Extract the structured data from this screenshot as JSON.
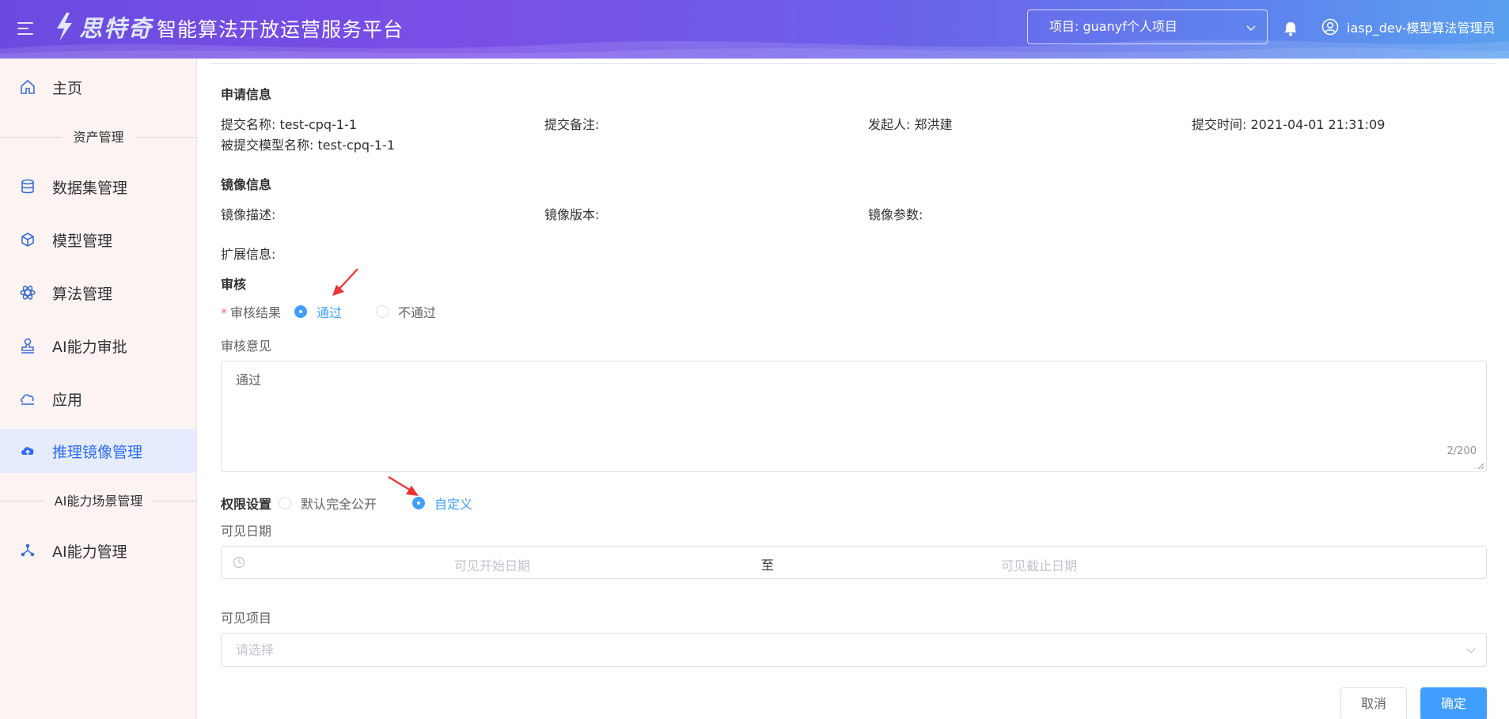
{
  "header": {
    "logo_text": "思特奇",
    "title": "智能算法开放运营服务平台",
    "project_select": "项目: guanyf个人项目",
    "user": "iasp_dev-模型算法管理员"
  },
  "sidebar": {
    "items": [
      {
        "label": "主页",
        "icon": "home-icon"
      },
      {
        "label": "数据集管理",
        "icon": "database-icon"
      },
      {
        "label": "模型管理",
        "icon": "cube-icon"
      },
      {
        "label": "算法管理",
        "icon": "atom-icon"
      },
      {
        "label": "AI能力审批",
        "icon": "stamp-icon"
      },
      {
        "label": "应用",
        "icon": "cloud-icon"
      },
      {
        "label": "推理镜像管理",
        "icon": "cloud-upload-icon",
        "active": true
      },
      {
        "label": "AI能力管理",
        "icon": "network-icon"
      }
    ],
    "groups": [
      "资产管理",
      "AI能力场景管理"
    ]
  },
  "application_info": {
    "title": "申请信息",
    "submit_name": "提交名称: test-cpq-1-1",
    "submit_note": "提交备注:",
    "initiator": "发起人: 郑洪建",
    "submit_time": "提交时间: 2021-04-01 21:31:09",
    "model_name": "被提交模型名称: test-cpq-1-1"
  },
  "image_info": {
    "title": "镜像信息",
    "description": "镜像描述:",
    "version": "镜像版本:",
    "params": "镜像参数:",
    "extension": "扩展信息:"
  },
  "review": {
    "title": "审核",
    "result_label": "审核结果",
    "required_mark": "*",
    "option_pass": "通过",
    "option_fail": "不通过",
    "selected": "pass",
    "opinion_label": "审核意见",
    "opinion_value": "通过",
    "opinion_count": "2/200"
  },
  "permission": {
    "label": "权限设置",
    "option_default": "默认完全公开",
    "option_custom": "自定义",
    "selected": "custom",
    "visible_date_label": "可见日期",
    "start_placeholder": "可见开始日期",
    "range_separator": "至",
    "end_placeholder": "可见截止日期",
    "visible_project_label": "可见项目",
    "project_placeholder": "请选择"
  },
  "actions": {
    "cancel": "取消",
    "confirm": "确定"
  },
  "colors": {
    "primary": "#409eff",
    "header_start": "#6a4be0",
    "header_end": "#5aa0f0",
    "active_nav": "#2f6cf5",
    "annotation_arrow": "#ee3333"
  }
}
